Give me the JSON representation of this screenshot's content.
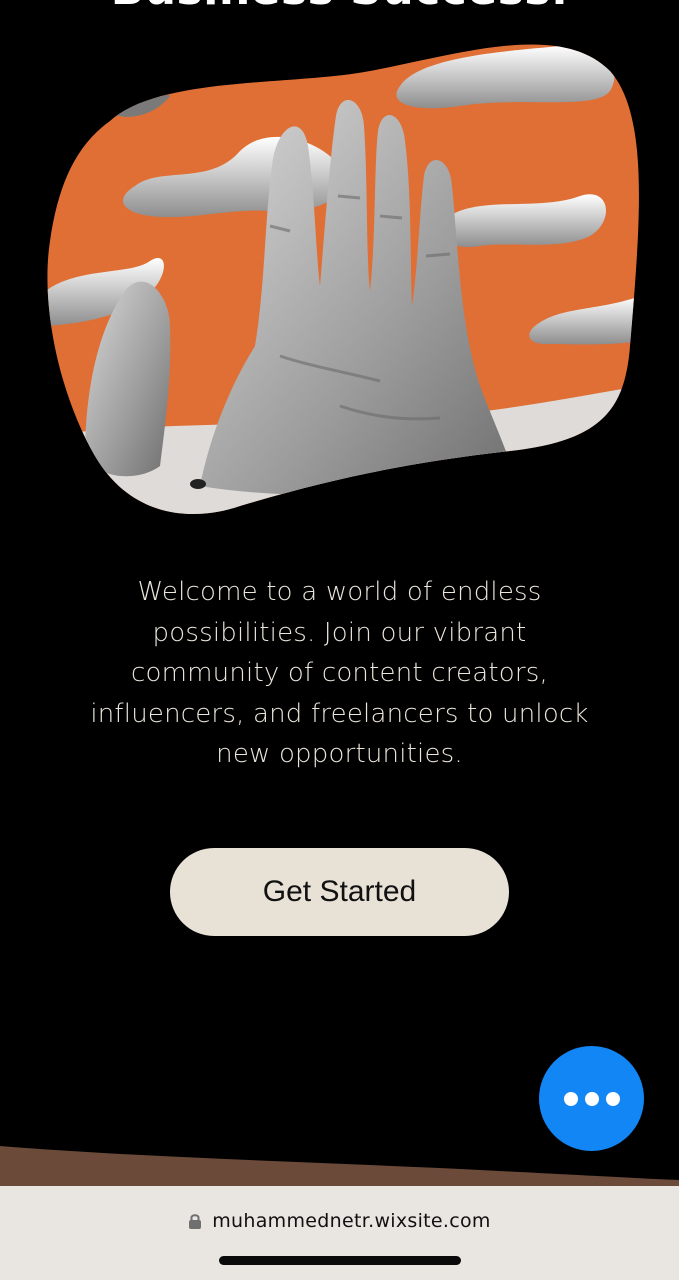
{
  "hero": {
    "heading": "Business Success."
  },
  "main": {
    "welcome_text": "Welcome to a world of endless possibilities. Join our vibrant community of content creators, influencers, and freelancers to unlock new opportunities.",
    "cta_label": "Get Started"
  },
  "chat_widget": {
    "icon": "more-dots-icon",
    "color": "#1386f5"
  },
  "browser": {
    "url": "muhammednetr.wixsite.com",
    "lock_icon": "lock-icon"
  },
  "colors": {
    "background": "#000000",
    "accent_orange": "#e06f35",
    "button_bg": "#e8e1d6",
    "footer_brown": "#6b4a3a"
  }
}
